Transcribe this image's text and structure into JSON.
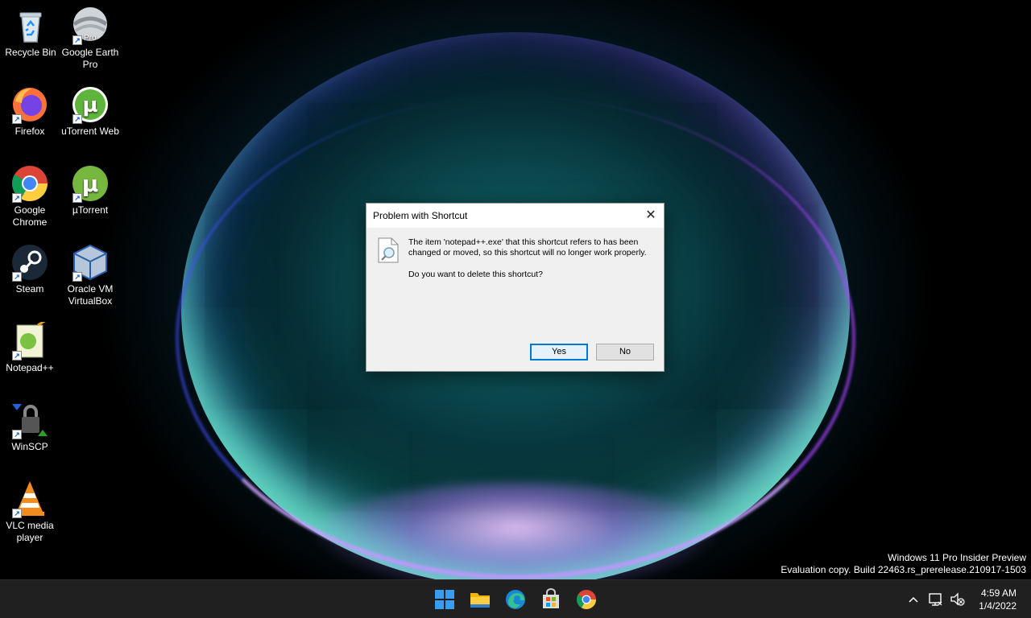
{
  "desktop_icons": [
    {
      "label": "Recycle Bin",
      "icon": "recycle-bin-icon"
    },
    {
      "label": "Google Earth Pro",
      "icon": "google-earth-icon",
      "badge": "Pro"
    },
    {
      "label": "Firefox",
      "icon": "firefox-icon"
    },
    {
      "label": "uTorrent Web",
      "icon": "utorrent-web-icon"
    },
    {
      "label": "Google Chrome",
      "icon": "chrome-icon"
    },
    {
      "label": "µTorrent",
      "icon": "utorrent-icon"
    },
    {
      "label": "Steam",
      "icon": "steam-icon"
    },
    {
      "label": "Oracle VM VirtualBox",
      "icon": "virtualbox-icon"
    },
    {
      "label": "Notepad++",
      "icon": "notepadpp-icon"
    },
    {
      "label": "WinSCP",
      "icon": "winscp-icon"
    },
    {
      "label": "VLC media player",
      "icon": "vlc-icon"
    }
  ],
  "dialog": {
    "title": "Problem with Shortcut",
    "message": "The item 'notepad++.exe' that this shortcut refers to has been changed or moved, so this shortcut will no longer work properly.",
    "question": "Do you want to delete this shortcut?",
    "yes_label": "Yes",
    "no_label": "No"
  },
  "watermark": {
    "line1": "Windows 11 Pro Insider Preview",
    "line2": "Evaluation copy. Build 22463.rs_prerelease.210917-1503"
  },
  "taskbar": {
    "apps": [
      "start-icon",
      "file-explorer-icon",
      "edge-icon",
      "store-icon",
      "chrome-icon"
    ],
    "tray_icons": [
      "chevron-up-icon",
      "network-icon",
      "speaker-muted-icon"
    ],
    "time": "4:59 AM",
    "date": "1/4/2022"
  },
  "colors": {
    "accent": "#0078d7",
    "taskbar": "#202020"
  }
}
